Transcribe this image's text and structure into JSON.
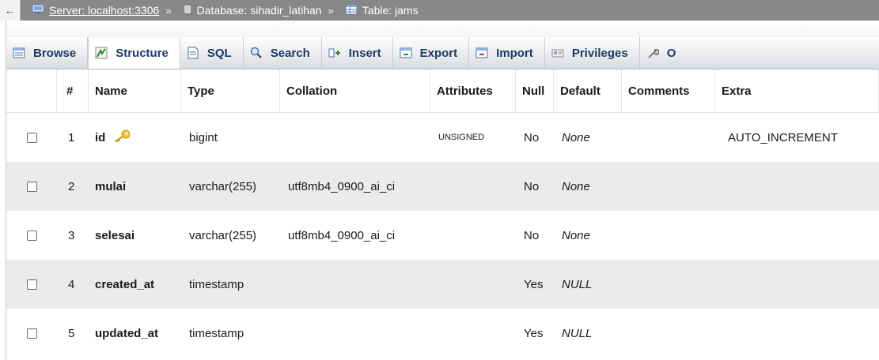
{
  "breadcrumb": {
    "back_glyph": "←",
    "server_label": "Server: localhost:3306",
    "sep1": "»",
    "database_label": "Database: sihadir_latihan",
    "sep2": "»",
    "table_label": "Table: jams"
  },
  "tabs": [
    {
      "label": "Browse",
      "icon": "browse-icon"
    },
    {
      "label": "Structure",
      "icon": "structure-icon"
    },
    {
      "label": "SQL",
      "icon": "sql-icon"
    },
    {
      "label": "Search",
      "icon": "search-icon"
    },
    {
      "label": "Insert",
      "icon": "insert-icon"
    },
    {
      "label": "Export",
      "icon": "export-icon"
    },
    {
      "label": "Import",
      "icon": "import-icon"
    },
    {
      "label": "Privileges",
      "icon": "privileges-icon"
    },
    {
      "label": "O",
      "icon": "operations-icon"
    }
  ],
  "columns": {
    "num": "#",
    "name": "Name",
    "type": "Type",
    "collation": "Collation",
    "attributes": "Attributes",
    "null": "Null",
    "default": "Default",
    "comments": "Comments",
    "extra": "Extra"
  },
  "rows": [
    {
      "num": "1",
      "name": "id",
      "type": "bigint",
      "collation": "",
      "attributes": "UNSIGNED",
      "null": "No",
      "default": "None",
      "comments": "",
      "extra": "AUTO_INCREMENT",
      "primary_key": true
    },
    {
      "num": "2",
      "name": "mulai",
      "type": "varchar(255)",
      "collation": "utf8mb4_0900_ai_ci",
      "attributes": "",
      "null": "No",
      "default": "None",
      "comments": "",
      "extra": ""
    },
    {
      "num": "3",
      "name": "selesai",
      "type": "varchar(255)",
      "collation": "utf8mb4_0900_ai_ci",
      "attributes": "",
      "null": "No",
      "default": "None",
      "comments": "",
      "extra": ""
    },
    {
      "num": "4",
      "name": "created_at",
      "type": "timestamp",
      "collation": "",
      "attributes": "",
      "null": "Yes",
      "default": "NULL",
      "comments": "",
      "extra": ""
    },
    {
      "num": "5",
      "name": "updated_at",
      "type": "timestamp",
      "collation": "",
      "attributes": "",
      "null": "Yes",
      "default": "NULL",
      "comments": "",
      "extra": ""
    }
  ],
  "colors": {
    "breadcrumb_bg": "#888888",
    "tab_text": "#1d3a66",
    "row_stripe": "#e9ebed"
  }
}
